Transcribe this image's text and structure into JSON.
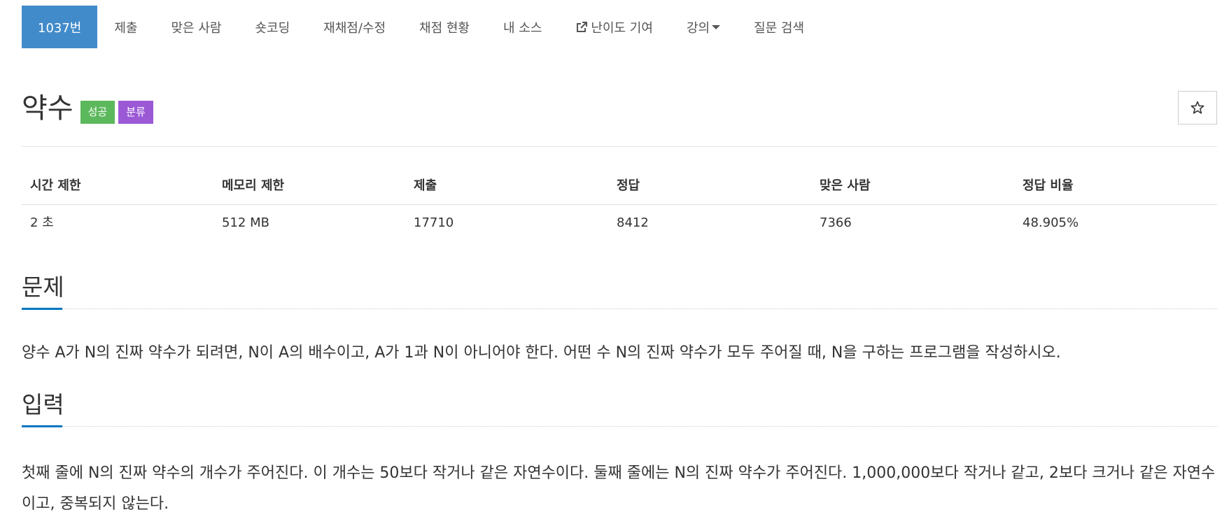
{
  "nav": {
    "items": [
      {
        "label": "1037번",
        "active": true
      },
      {
        "label": "제출"
      },
      {
        "label": "맞은 사람"
      },
      {
        "label": "숏코딩"
      },
      {
        "label": "재채점/수정"
      },
      {
        "label": "채점 현황"
      },
      {
        "label": "내 소스"
      },
      {
        "label": "난이도 기여",
        "icon": "external-link-icon"
      },
      {
        "label": "강의",
        "icon": "caret-down-icon"
      },
      {
        "label": "질문 검색"
      }
    ],
    "active_color": "#428bca"
  },
  "problem": {
    "title": "약수",
    "badges": {
      "success": {
        "label": "성공",
        "color": "#5cb85c"
      },
      "category": {
        "label": "분류",
        "color": "#9b59d6"
      }
    },
    "star_icon": "star-outline-icon"
  },
  "stats": {
    "headers": [
      "시간 제한",
      "메모리 제한",
      "제출",
      "정답",
      "맞은 사람",
      "정답 비율"
    ],
    "values": [
      "2 초",
      "512 MB",
      "17710",
      "8412",
      "7366",
      "48.905%"
    ]
  },
  "sections": {
    "problem": {
      "heading": "문제",
      "text": "양수 A가 N의 진짜 약수가 되려면, N이 A의 배수이고, A가 1과 N이 아니어야 한다. 어떤 수 N의 진짜 약수가 모두 주어질 때, N을 구하는 프로그램을 작성하시오."
    },
    "input": {
      "heading": "입력",
      "text": "첫째 줄에 N의 진짜 약수의 개수가 주어진다. 이 개수는 50보다 작거나 같은 자연수이다. 둘째 줄에는 N의 진짜 약수가 주어진다. 1,000,000보다 작거나 같고, 2보다 크거나 같은 자연수이고, 중복되지 않는다."
    },
    "accent_color": "#0076c0"
  }
}
